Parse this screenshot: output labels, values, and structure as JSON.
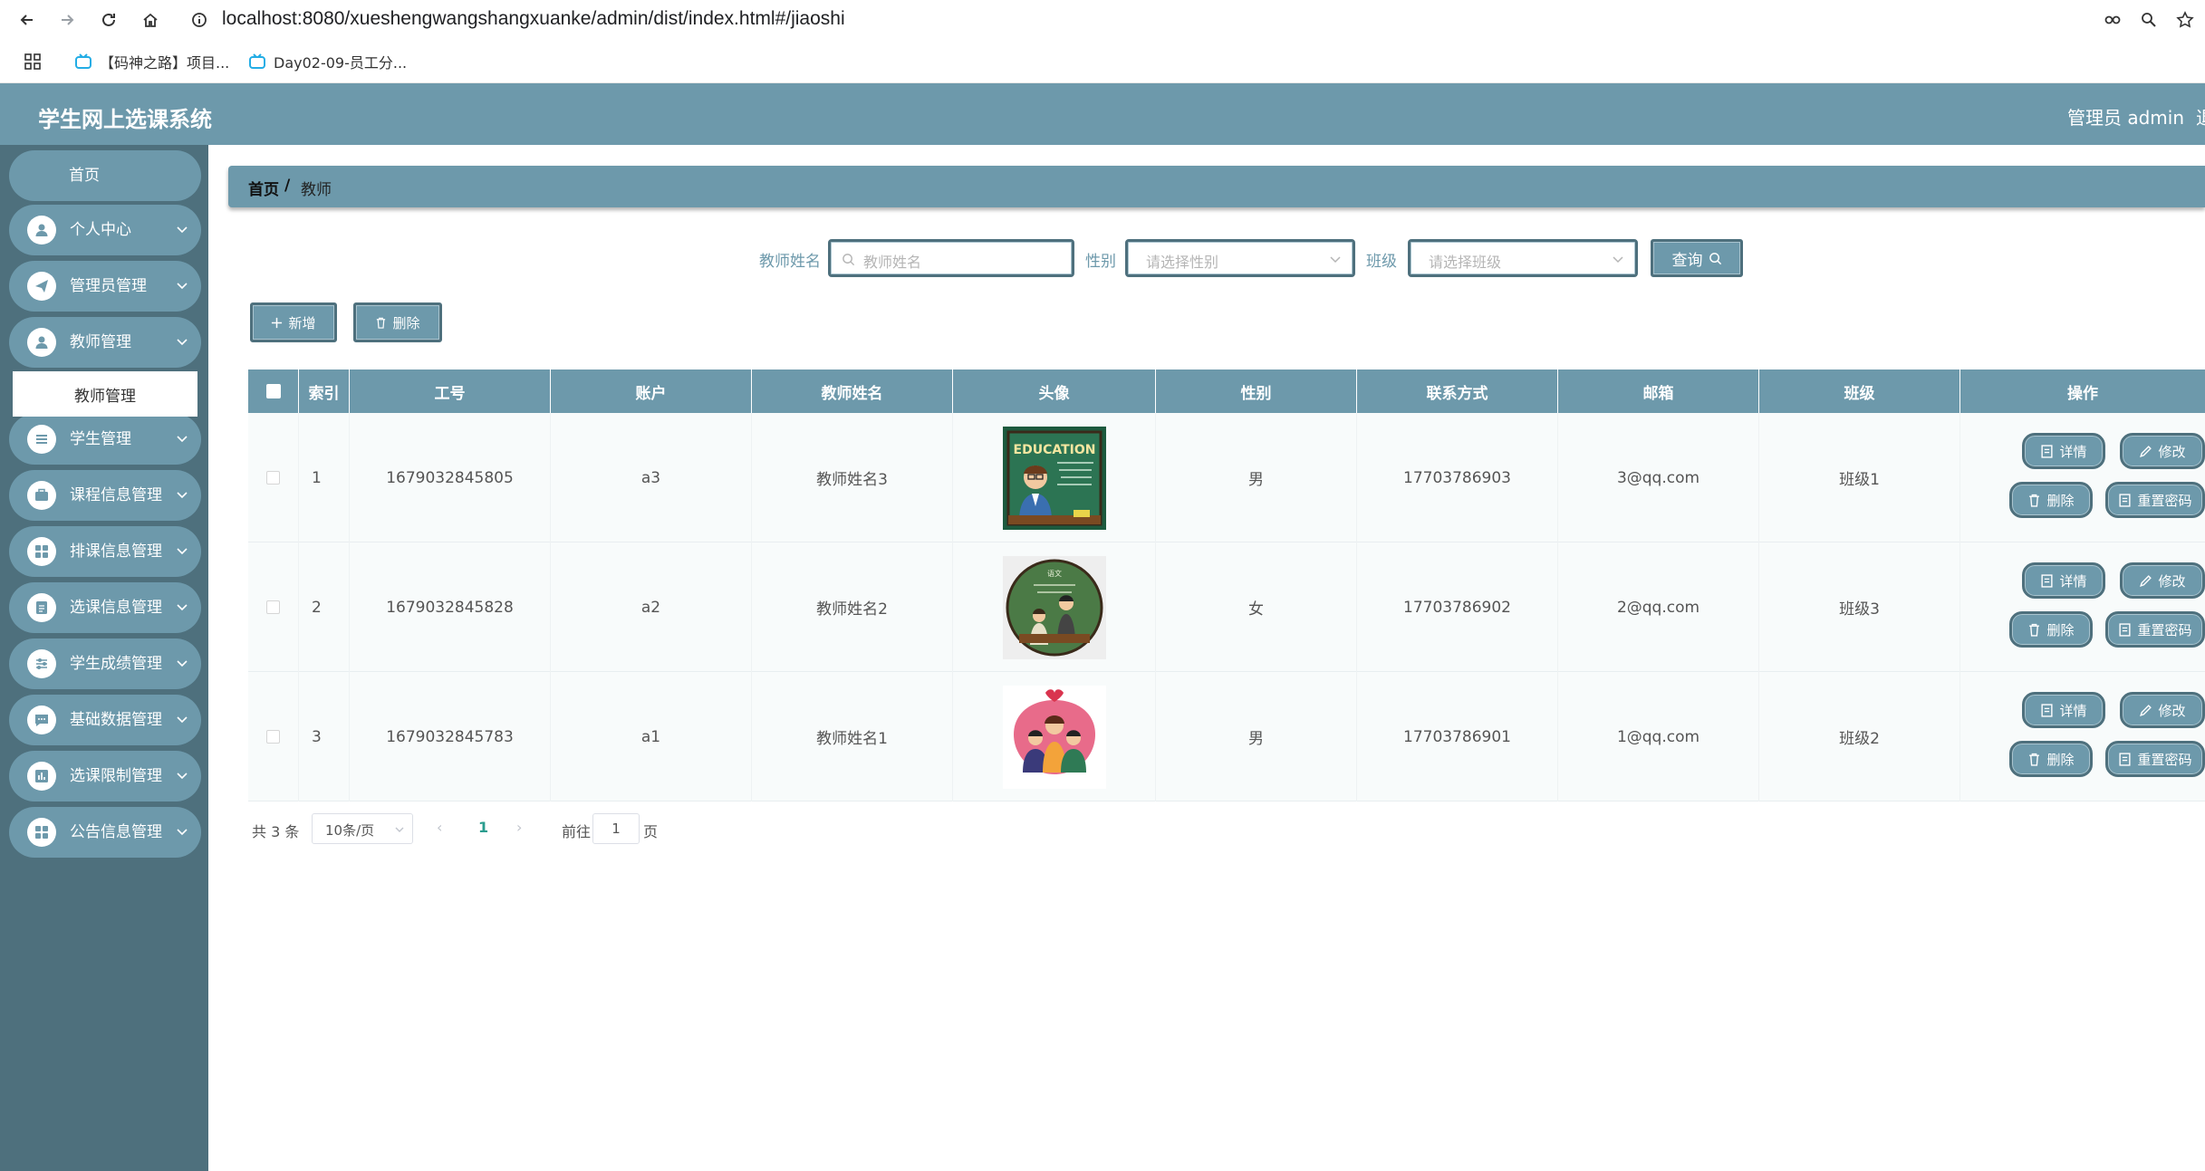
{
  "browser": {
    "url": "localhost:8080/xueshengwangshangxuanke/admin/dist/index.html#/jiaoshi",
    "bookmarks": [
      {
        "label": "【码神之路】项目..."
      },
      {
        "label": "Day02-09-员工分..."
      }
    ]
  },
  "header": {
    "title": "学生网上选课系统",
    "user": "管理员 admin",
    "logout": "退"
  },
  "sidebar": {
    "home": "首页",
    "items": [
      {
        "label": "个人中心",
        "icon": "user-icon"
      },
      {
        "label": "管理员管理",
        "icon": "send-icon"
      },
      {
        "label": "教师管理",
        "icon": "user-icon"
      },
      {
        "label": "学生管理",
        "icon": "list-icon"
      },
      {
        "label": "课程信息管理",
        "icon": "briefcase-icon"
      },
      {
        "label": "排课信息管理",
        "icon": "grid-icon"
      },
      {
        "label": "选课信息管理",
        "icon": "doc-icon"
      },
      {
        "label": "学生成绩管理",
        "icon": "sliders-icon"
      },
      {
        "label": "基础数据管理",
        "icon": "chat-icon"
      },
      {
        "label": "选课限制管理",
        "icon": "chart-icon"
      },
      {
        "label": "公告信息管理",
        "icon": "grid-icon"
      }
    ],
    "active_sub": "教师管理"
  },
  "breadcrumb": {
    "home": "首页",
    "separator": "/",
    "current": "教师"
  },
  "search": {
    "name_label": "教师姓名",
    "name_placeholder": "教师姓名",
    "gender_label": "性别",
    "gender_placeholder": "请选择性别",
    "class_label": "班级",
    "class_placeholder": "请选择班级",
    "query_label": "查询"
  },
  "actions": {
    "add_label": "新增",
    "delete_label": "删除"
  },
  "table": {
    "headers": [
      "索引",
      "工号",
      "账户",
      "教师姓名",
      "头像",
      "性别",
      "联系方式",
      "邮箱",
      "班级",
      "操作"
    ],
    "rows": [
      {
        "index": "1",
        "job_no": "1679032845805",
        "account": "a3",
        "name": "教师姓名3",
        "avatar": "education-avatar",
        "gender": "男",
        "phone": "17703786903",
        "email": "3@qq.com",
        "class": "班级1"
      },
      {
        "index": "2",
        "job_no": "1679032845828",
        "account": "a2",
        "name": "教师姓名2",
        "avatar": "classroom-avatar",
        "gender": "女",
        "phone": "17703786902",
        "email": "2@qq.com",
        "class": "班级3"
      },
      {
        "index": "3",
        "job_no": "1679032845783",
        "account": "a1",
        "name": "教师姓名1",
        "avatar": "family-avatar",
        "gender": "男",
        "phone": "17703786901",
        "email": "1@qq.com",
        "class": "班级2"
      }
    ],
    "ops": {
      "detail": "详情",
      "edit": "修改",
      "delete": "删除",
      "reset": "重置密码"
    }
  },
  "pagination": {
    "total": "共 3 条",
    "page_size": "10条/页",
    "current": "1",
    "goto_label": "前往",
    "goto_value": "1",
    "page_suffix": "页"
  },
  "colors": {
    "primary": "#6d99ab",
    "sidebar_bg": "#4e707d",
    "border": "#4e707d"
  }
}
